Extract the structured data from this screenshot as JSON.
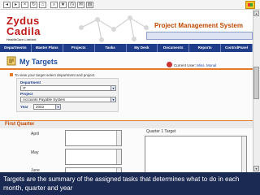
{
  "toolbar": {
    "icons": [
      "back-icon",
      "forward-icon",
      "stop-icon",
      "refresh-icon",
      "home-icon",
      "search-icon",
      "favorites-icon",
      "history-icon",
      "mail-icon",
      "print-icon"
    ]
  },
  "header": {
    "logo_line1": "Zydus",
    "logo_line2": "Cadila",
    "logo_sub": "HealthCare Limited",
    "system_title": "Project Management System"
  },
  "nav": {
    "items": [
      "Departments",
      "Master Plans",
      "Projects",
      "Tasks",
      "My Desk",
      "Documents",
      "Reports",
      "ControlPanel"
    ]
  },
  "page": {
    "title": "My Targets",
    "current_user_label": "Current User:",
    "current_user_name": "Miss. Monal",
    "hint": "To view your target select department and project."
  },
  "form": {
    "department_label": "Department",
    "department_value": "IT",
    "project_label": "Project",
    "project_value": "Accounts Payable System",
    "year_label": "Year",
    "year_value": "2003"
  },
  "section": {
    "title": "First Quarter",
    "months": [
      "April",
      "May",
      "June"
    ],
    "quarter_label": "Quarter 1 Target"
  },
  "caption": {
    "text": "Targets are the summary of the assigned tasks that determines what to do in each month, quarter and year"
  },
  "colors": {
    "brand_red": "#c01818",
    "nav_blue": "#1f3c88",
    "accent_orange": "#e37a2c",
    "caption_bg": "#1b2a52"
  }
}
